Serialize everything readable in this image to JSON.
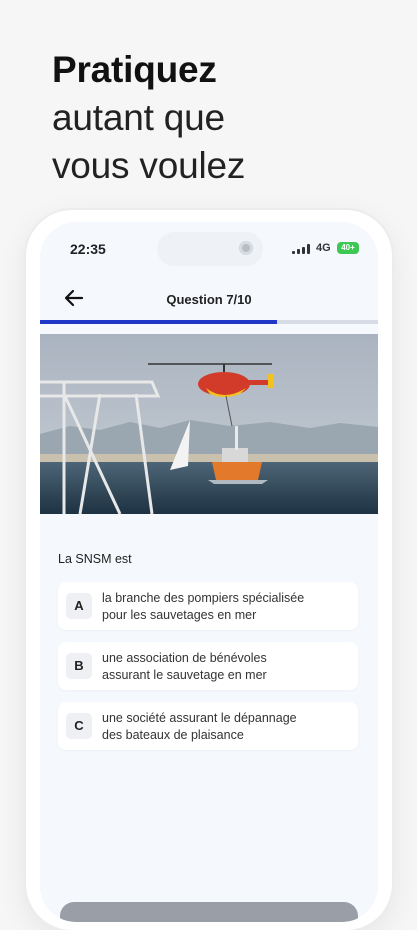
{
  "headline": {
    "bold": "Pratiquez",
    "line2": "autant que",
    "line3": "vous voulez"
  },
  "status": {
    "time": "22:35",
    "network": "4G",
    "battery": "40+"
  },
  "appbar": {
    "title": "Question 7/10"
  },
  "progress": {
    "value": 0.7
  },
  "question": {
    "text": "La SNSM est"
  },
  "answers": [
    {
      "letter": "A",
      "line1": "la branche des pompiers spécialisée",
      "line2": "pour les sauvetages en mer"
    },
    {
      "letter": "B",
      "line1": "une association de bénévoles",
      "line2": "assurant le sauvetage en mer"
    },
    {
      "letter": "C",
      "line1": "une société assurant le dépannage",
      "line2": "des bateaux de plaisance"
    }
  ],
  "colors": {
    "accent": "#2037c8",
    "background": "#f5f8fd"
  },
  "icons": {
    "back": "arrow-left-icon"
  }
}
